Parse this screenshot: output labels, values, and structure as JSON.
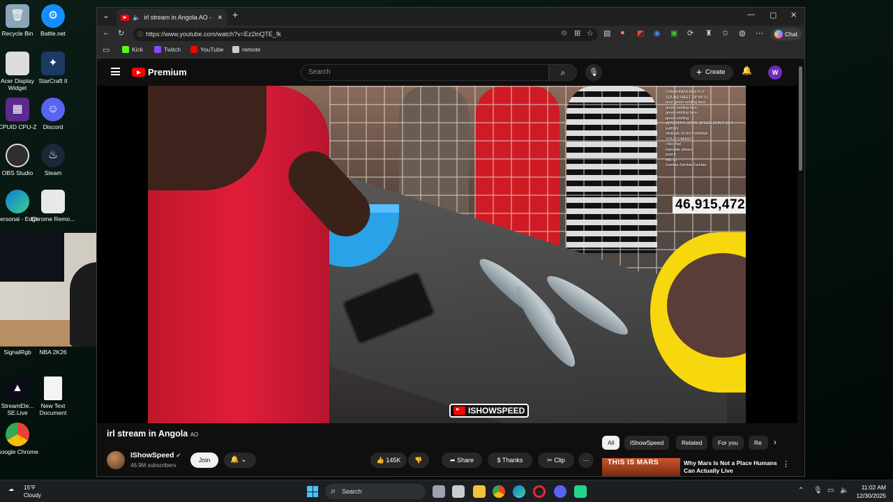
{
  "desktop": {
    "icons": [
      {
        "label": "Recycle Bin"
      },
      {
        "label": "Battle.net"
      },
      {
        "label": "Acer Display Widget"
      },
      {
        "label": "StarCraft II"
      },
      {
        "label": "CPUID CPU-Z"
      },
      {
        "label": "Discord"
      },
      {
        "label": "OBS Studio"
      },
      {
        "label": "Steam"
      },
      {
        "label": "Personal - Edge"
      },
      {
        "label": "Chrome Remo..."
      },
      {
        "label": "SignalRgb"
      },
      {
        "label": "NBA 2K26"
      },
      {
        "label": "StreamEle... SE.Live"
      },
      {
        "label": "New Text Document"
      },
      {
        "label": "Google Chrome"
      }
    ]
  },
  "browser": {
    "tab_title": "irl stream in Angola AO - YouTube",
    "url": "https://www.youtube.com/watch?v=Ez2inQTE_fk",
    "chat_label": "Chat",
    "favorites": [
      {
        "label": "Kick",
        "color": "#53fc18"
      },
      {
        "label": "Twitch",
        "color": "#9146ff"
      },
      {
        "label": "YouTube",
        "color": "#ff0000"
      },
      {
        "label": "remote",
        "color": "#cccccc"
      }
    ]
  },
  "youtube": {
    "logo_text": "Premium",
    "search_placeholder": "Search",
    "create_label": "Create",
    "avatar_letter": "W",
    "video": {
      "overlay_viewcount": "46,915,472",
      "watermark": "ISHOWSPEED",
      "chat_lines": [
        "CANAVINGA AND FLY",
        "SQUAD MEET UP WITH",
        "face-green-smiling face-",
        "green-smiling face-",
        "green-smiling face-",
        "green-smiling",
        "@POTATO: HOPE SPEED DON'T GET",
        "EATEN",
        "WHERE IN BOTSWANA",
        "YOU COMING?",
        "I like that",
        "translate please",
        "post it",
        "fifth lol",
        "Zambia Zambia Zambia"
      ]
    },
    "title": "irl stream in Angola",
    "title_suffix": "AO",
    "channel": "IShowSpeed",
    "subscribers": "46.9M subscribers",
    "join_label": "Join",
    "likes": "145K",
    "share_label": "Share",
    "thanks_label": "Thanks",
    "clip_label": "Clip",
    "chips": [
      "All",
      "IShowSpeed",
      "Related",
      "For you",
      "Re"
    ],
    "related": {
      "thumb_text": "THIS IS MARS",
      "title": "Why Mars Is Not a Place Humans Can Actually Live"
    }
  },
  "taskbar": {
    "temperature": "15°F",
    "condition": "Cloudy",
    "search_label": "Search",
    "time": "11:02 AM",
    "date": "12/30/2025"
  }
}
